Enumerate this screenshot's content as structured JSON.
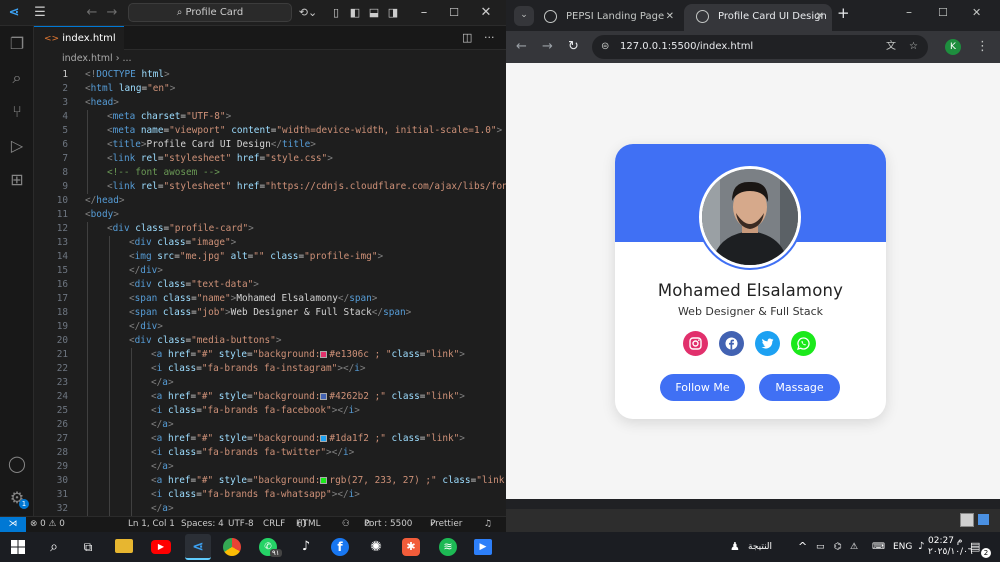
{
  "vscode": {
    "search_label": "Profile Card",
    "tab_label": "index.html",
    "breadcrumb_file": "index.html",
    "breadcrumb_more": "...",
    "lines": [
      {
        "n": "1",
        "indent": 0,
        "parts": [
          [
            "p",
            "<!"
          ],
          [
            "t",
            "DOCTYPE"
          ],
          [
            "x",
            " "
          ],
          [
            "a",
            "html"
          ],
          [
            "p",
            ">"
          ]
        ]
      },
      {
        "n": "2",
        "indent": 0,
        "parts": [
          [
            "p",
            "<"
          ],
          [
            "t",
            "html"
          ],
          [
            "x",
            " "
          ],
          [
            "a",
            "lang"
          ],
          [
            "x",
            "="
          ],
          [
            "s",
            "\"en\""
          ],
          [
            "p",
            ">"
          ]
        ]
      },
      {
        "n": "3",
        "indent": 0,
        "parts": [
          [
            "p",
            "<"
          ],
          [
            "t",
            "head"
          ],
          [
            "p",
            ">"
          ]
        ]
      },
      {
        "n": "4",
        "indent": 1,
        "parts": [
          [
            "p",
            "<"
          ],
          [
            "t",
            "meta"
          ],
          [
            "x",
            " "
          ],
          [
            "a",
            "charset"
          ],
          [
            "x",
            "="
          ],
          [
            "s",
            "\"UTF-8\""
          ],
          [
            "p",
            ">"
          ]
        ]
      },
      {
        "n": "5",
        "indent": 1,
        "parts": [
          [
            "p",
            "<"
          ],
          [
            "t",
            "meta"
          ],
          [
            "x",
            " "
          ],
          [
            "a",
            "name"
          ],
          [
            "x",
            "="
          ],
          [
            "s",
            "\"viewport\""
          ],
          [
            "x",
            " "
          ],
          [
            "a",
            "content"
          ],
          [
            "x",
            "="
          ],
          [
            "s",
            "\"width=device-width, initial-scale=1.0\""
          ],
          [
            "p",
            ">"
          ]
        ]
      },
      {
        "n": "6",
        "indent": 1,
        "parts": [
          [
            "p",
            "<"
          ],
          [
            "t",
            "title"
          ],
          [
            "p",
            ">"
          ],
          [
            "x",
            "Profile Card UI Design"
          ],
          [
            "p",
            "</"
          ],
          [
            "t",
            "title"
          ],
          [
            "p",
            ">"
          ]
        ]
      },
      {
        "n": "7",
        "indent": 1,
        "parts": [
          [
            "p",
            "<"
          ],
          [
            "t",
            "link"
          ],
          [
            "x",
            " "
          ],
          [
            "a",
            "rel"
          ],
          [
            "x",
            "="
          ],
          [
            "s",
            "\"stylesheet\""
          ],
          [
            "x",
            " "
          ],
          [
            "a",
            "href"
          ],
          [
            "x",
            "="
          ],
          [
            "s",
            "\"style.css\""
          ],
          [
            "p",
            ">"
          ]
        ]
      },
      {
        "n": "8",
        "indent": 1,
        "parts": [
          [
            "c",
            "<!-- font awosem -->"
          ]
        ]
      },
      {
        "n": "9",
        "indent": 1,
        "parts": [
          [
            "p",
            "<"
          ],
          [
            "t",
            "link"
          ],
          [
            "x",
            " "
          ],
          [
            "a",
            "rel"
          ],
          [
            "x",
            "="
          ],
          [
            "s",
            "\"stylesheet\""
          ],
          [
            "x",
            " "
          ],
          [
            "a",
            "href"
          ],
          [
            "x",
            "="
          ],
          [
            "s",
            "\"https://cdnjs.cloudflare.com/ajax/libs/fon"
          ]
        ]
      },
      {
        "n": "10",
        "indent": 0,
        "parts": [
          [
            "p",
            "</"
          ],
          [
            "t",
            "head"
          ],
          [
            "p",
            ">"
          ]
        ]
      },
      {
        "n": "11",
        "indent": 0,
        "parts": [
          [
            "p",
            "<"
          ],
          [
            "t",
            "body"
          ],
          [
            "p",
            ">"
          ]
        ]
      },
      {
        "n": "12",
        "indent": 1,
        "parts": [
          [
            "p",
            "<"
          ],
          [
            "t",
            "div"
          ],
          [
            "x",
            " "
          ],
          [
            "a",
            "class"
          ],
          [
            "x",
            "="
          ],
          [
            "s",
            "\"profile-card\""
          ],
          [
            "p",
            ">"
          ]
        ]
      },
      {
        "n": "13",
        "indent": 2,
        "parts": [
          [
            "p",
            "<"
          ],
          [
            "t",
            "div"
          ],
          [
            "x",
            " "
          ],
          [
            "a",
            "class"
          ],
          [
            "x",
            "="
          ],
          [
            "s",
            "\"image\""
          ],
          [
            "p",
            ">"
          ]
        ]
      },
      {
        "n": "14",
        "indent": 2,
        "parts": [
          [
            "p",
            "<"
          ],
          [
            "t",
            "img"
          ],
          [
            "x",
            " "
          ],
          [
            "a",
            "src"
          ],
          [
            "x",
            "="
          ],
          [
            "s",
            "\"me.jpg\""
          ],
          [
            "x",
            " "
          ],
          [
            "a",
            "alt"
          ],
          [
            "x",
            "="
          ],
          [
            "s",
            "\"\""
          ],
          [
            "x",
            " "
          ],
          [
            "a",
            "class"
          ],
          [
            "x",
            "="
          ],
          [
            "s",
            "\"profile-img\""
          ],
          [
            "p",
            ">"
          ]
        ]
      },
      {
        "n": "15",
        "indent": 2,
        "parts": [
          [
            "p",
            "</"
          ],
          [
            "t",
            "div"
          ],
          [
            "p",
            ">"
          ]
        ]
      },
      {
        "n": "16",
        "indent": 2,
        "parts": [
          [
            "p",
            "<"
          ],
          [
            "t",
            "div"
          ],
          [
            "x",
            " "
          ],
          [
            "a",
            "class"
          ],
          [
            "x",
            "="
          ],
          [
            "s",
            "\"text-data\""
          ],
          [
            "p",
            ">"
          ]
        ]
      },
      {
        "n": "17",
        "indent": 2,
        "parts": [
          [
            "p",
            "<"
          ],
          [
            "t",
            "span"
          ],
          [
            "x",
            " "
          ],
          [
            "a",
            "class"
          ],
          [
            "x",
            "="
          ],
          [
            "s",
            "\"name\""
          ],
          [
            "p",
            ">"
          ],
          [
            "x",
            "Mohamed Elsalamony"
          ],
          [
            "p",
            "</"
          ],
          [
            "t",
            "span"
          ],
          [
            "p",
            ">"
          ]
        ]
      },
      {
        "n": "18",
        "indent": 2,
        "parts": [
          [
            "p",
            "<"
          ],
          [
            "t",
            "span"
          ],
          [
            "x",
            " "
          ],
          [
            "a",
            "class"
          ],
          [
            "x",
            "="
          ],
          [
            "s",
            "\"job\""
          ],
          [
            "p",
            ">"
          ],
          [
            "x",
            "Web Designer & Full Stack"
          ],
          [
            "p",
            "</"
          ],
          [
            "t",
            "span"
          ],
          [
            "p",
            ">"
          ]
        ]
      },
      {
        "n": "19",
        "indent": 2,
        "parts": [
          [
            "p",
            "</"
          ],
          [
            "t",
            "div"
          ],
          [
            "p",
            ">"
          ]
        ]
      },
      {
        "n": "20",
        "indent": 2,
        "parts": [
          [
            "p",
            "<"
          ],
          [
            "t",
            "div"
          ],
          [
            "x",
            " "
          ],
          [
            "a",
            "class"
          ],
          [
            "x",
            "="
          ],
          [
            "s",
            "\"media-buttons\""
          ],
          [
            "p",
            ">"
          ]
        ]
      },
      {
        "n": "21",
        "indent": 3,
        "parts": [
          [
            "p",
            "<"
          ],
          [
            "t",
            "a"
          ],
          [
            "x",
            " "
          ],
          [
            "a",
            "href"
          ],
          [
            "x",
            "="
          ],
          [
            "s",
            "\"#\""
          ],
          [
            "x",
            " "
          ],
          [
            "a",
            "style"
          ],
          [
            "x",
            "="
          ],
          [
            "s",
            "\"background:"
          ],
          [
            "sw",
            "#e1306c"
          ],
          [
            "s",
            "#e1306c ; \""
          ],
          [
            "a",
            "class"
          ],
          [
            "x",
            "="
          ],
          [
            "s",
            "\"link\""
          ],
          [
            "p",
            ">"
          ]
        ]
      },
      {
        "n": "22",
        "indent": 3,
        "parts": [
          [
            "p",
            "<"
          ],
          [
            "t",
            "i"
          ],
          [
            "x",
            " "
          ],
          [
            "a",
            "class"
          ],
          [
            "x",
            "="
          ],
          [
            "s",
            "\"fa-brands fa-instagram\""
          ],
          [
            "p",
            "></"
          ],
          [
            "t",
            "i"
          ],
          [
            "p",
            ">"
          ]
        ]
      },
      {
        "n": "23",
        "indent": 3,
        "parts": [
          [
            "p",
            "</"
          ],
          [
            "t",
            "a"
          ],
          [
            "p",
            ">"
          ]
        ]
      },
      {
        "n": "24",
        "indent": 3,
        "parts": [
          [
            "p",
            "<"
          ],
          [
            "t",
            "a"
          ],
          [
            "x",
            " "
          ],
          [
            "a",
            "href"
          ],
          [
            "x",
            "="
          ],
          [
            "s",
            "\"#\""
          ],
          [
            "x",
            " "
          ],
          [
            "a",
            "style"
          ],
          [
            "x",
            "="
          ],
          [
            "s",
            "\"background:"
          ],
          [
            "sw",
            "#4262b2"
          ],
          [
            "s",
            "#4262b2 ;\""
          ],
          [
            "x",
            " "
          ],
          [
            "a",
            "class"
          ],
          [
            "x",
            "="
          ],
          [
            "s",
            "\"link\""
          ],
          [
            "p",
            ">"
          ]
        ]
      },
      {
        "n": "25",
        "indent": 3,
        "parts": [
          [
            "p",
            "<"
          ],
          [
            "t",
            "i"
          ],
          [
            "x",
            " "
          ],
          [
            "a",
            "class"
          ],
          [
            "x",
            "="
          ],
          [
            "s",
            "\"fa-brands fa-facebook\""
          ],
          [
            "p",
            "></"
          ],
          [
            "t",
            "i"
          ],
          [
            "p",
            ">"
          ]
        ]
      },
      {
        "n": "26",
        "indent": 3,
        "parts": [
          [
            "p",
            "</"
          ],
          [
            "t",
            "a"
          ],
          [
            "p",
            ">"
          ]
        ]
      },
      {
        "n": "27",
        "indent": 3,
        "parts": [
          [
            "p",
            "<"
          ],
          [
            "t",
            "a"
          ],
          [
            "x",
            " "
          ],
          [
            "a",
            "href"
          ],
          [
            "x",
            "="
          ],
          [
            "s",
            "\"#\""
          ],
          [
            "x",
            " "
          ],
          [
            "a",
            "style"
          ],
          [
            "x",
            "="
          ],
          [
            "s",
            "\"background:"
          ],
          [
            "sw",
            "#1da1f2"
          ],
          [
            "s",
            "#1da1f2 ;\""
          ],
          [
            "x",
            " "
          ],
          [
            "a",
            "class"
          ],
          [
            "x",
            "="
          ],
          [
            "s",
            "\"link\""
          ],
          [
            "p",
            ">"
          ]
        ]
      },
      {
        "n": "28",
        "indent": 3,
        "parts": [
          [
            "p",
            "<"
          ],
          [
            "t",
            "i"
          ],
          [
            "x",
            " "
          ],
          [
            "a",
            "class"
          ],
          [
            "x",
            "="
          ],
          [
            "s",
            "\"fa-brands fa-twitter\""
          ],
          [
            "p",
            "></"
          ],
          [
            "t",
            "i"
          ],
          [
            "p",
            ">"
          ]
        ]
      },
      {
        "n": "29",
        "indent": 3,
        "parts": [
          [
            "p",
            "</"
          ],
          [
            "t",
            "a"
          ],
          [
            "p",
            ">"
          ]
        ]
      },
      {
        "n": "30",
        "indent": 3,
        "parts": [
          [
            "p",
            "<"
          ],
          [
            "t",
            "a"
          ],
          [
            "x",
            " "
          ],
          [
            "a",
            "href"
          ],
          [
            "x",
            "="
          ],
          [
            "s",
            "\"#\""
          ],
          [
            "x",
            " "
          ],
          [
            "a",
            "style"
          ],
          [
            "x",
            "="
          ],
          [
            "s",
            "\"background:"
          ],
          [
            "sw",
            "#1be91b"
          ],
          [
            "s",
            "rgb(27, 233, 27) ;\""
          ],
          [
            "x",
            " "
          ],
          [
            "a",
            "class"
          ],
          [
            "x",
            "="
          ],
          [
            "s",
            "\"link"
          ]
        ]
      },
      {
        "n": "31",
        "indent": 3,
        "parts": [
          [
            "p",
            "<"
          ],
          [
            "t",
            "i"
          ],
          [
            "x",
            " "
          ],
          [
            "a",
            "class"
          ],
          [
            "x",
            "="
          ],
          [
            "s",
            "\"fa-brands fa-whatsapp\""
          ],
          [
            "p",
            "></"
          ],
          [
            "t",
            "i"
          ],
          [
            "p",
            ">"
          ]
        ]
      },
      {
        "n": "32",
        "indent": 3,
        "parts": [
          [
            "p",
            "</"
          ],
          [
            "t",
            "a"
          ],
          [
            "p",
            ">"
          ]
        ]
      }
    ],
    "status": {
      "problems": "⊗ 0 ⚠ 0",
      "position": "Ln 1, Col 1",
      "spaces": "Spaces: 4",
      "encoding": "UTF-8",
      "eol": "CRLF",
      "language": "HTML",
      "port": "Port : 5500",
      "prettier": "Prettier",
      "accounts_badge": "1"
    }
  },
  "chrome": {
    "tabs": [
      {
        "label": "PEPSI Landing Page",
        "active": false
      },
      {
        "label": "Profile Card UI Design",
        "active": true
      }
    ],
    "url": "127.0.0.1:5500/index.html",
    "profile_initial": "K"
  },
  "card": {
    "name": "Mohamed Elsalamony",
    "job": "Web Designer & Full Stack",
    "accent": "#4070f4",
    "social": [
      {
        "name": "instagram",
        "color": "#e1306c"
      },
      {
        "name": "facebook",
        "color": "#4262b2"
      },
      {
        "name": "twitter",
        "color": "#1da1f2"
      },
      {
        "name": "whatsapp",
        "color": "#1be91b"
      }
    ],
    "buttons": [
      "Follow Me",
      "Massage"
    ]
  },
  "taskbar": {
    "weather_text": "النتيجة",
    "lang": "ENG",
    "time": "02:27 م",
    "date": "٢٠٢٥/١٠/٠٦",
    "notification_count": "2",
    "whatsapp_badge": "٩١"
  }
}
